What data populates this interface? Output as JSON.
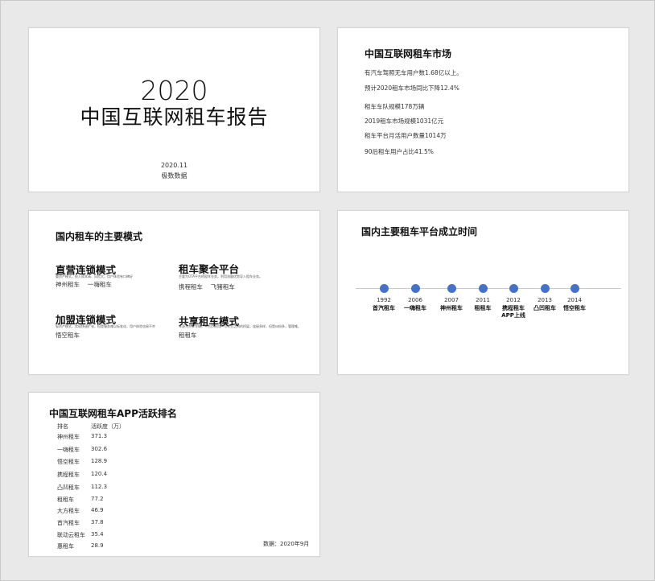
{
  "slide1": {
    "year": "2020",
    "title": "中国互联网租车报告",
    "date": "2020.11",
    "source": "极数数据"
  },
  "slide2": {
    "heading": "中国互联网租车市场",
    "lines": [
      "有汽车驾照无车用户数1.68亿以上。",
      "预计2020租车市场同比下降12.4%",
      "租车车队规模178万辆",
      "2019租车市场规模1031亿元",
      "租车平台月活用户数量1014万",
      "90后租车用户占比41.5%"
    ]
  },
  "slide3": {
    "heading": "国内租车的主要模式",
    "modes": [
      {
        "title": "直营连锁模式",
        "desc": "重资产模式，投入成本高、风险大，用户体验有口碑好",
        "examples": "神州租车　 一嗨租车"
      },
      {
        "title": "租车聚合平台",
        "desc": "主要为OTA平台的租车业务，利用流量优势导入租车业务。",
        "examples": "携程租车　 飞猪租车"
      },
      {
        "title": "加盟连锁模式",
        "desc": "轻资产模式，实现快速扩张，但是服务难以标准化，用户体验也易不齐",
        "examples": "悟空租车"
      },
      {
        "title": "共享租车模式",
        "desc": "车源为共享车辆，平台负责用户与车主之间的桥梁，连接多样，但是纠纷多，管理难。",
        "examples": "租租车"
      }
    ]
  },
  "slide4": {
    "heading": "国内主要租车平台成立时间",
    "events": [
      {
        "year": "1992",
        "name": "首汽租车"
      },
      {
        "year": "2006",
        "name": "一嗨租车"
      },
      {
        "year": "2007",
        "name": "神州租车"
      },
      {
        "year": "2011",
        "name": "租租车"
      },
      {
        "year": "2012",
        "name": "携程租车APP上线"
      },
      {
        "year": "2013",
        "name": "凸凹租车"
      },
      {
        "year": "2014",
        "name": "悟空租车"
      }
    ],
    "dot_color": "#4472c4"
  },
  "slide5": {
    "heading": "中国互联网租车APP活跃排名",
    "col_name": "排名",
    "col_value": "活跃度（万）",
    "rows": [
      {
        "name": "神州租车",
        "value": "371.3"
      },
      {
        "name": "一嗨租车",
        "value": "302.6"
      },
      {
        "name": "悟空租车",
        "value": "128.9"
      },
      {
        "name": "携程租车",
        "value": "120.4"
      },
      {
        "name": "凸凹租车",
        "value": "112.3"
      },
      {
        "name": "租租车",
        "value": "77.2"
      },
      {
        "name": "大方租车",
        "value": "46.9"
      },
      {
        "name": "首汽租车",
        "value": "37.8"
      },
      {
        "name": "联动云租车",
        "value": "35.4"
      },
      {
        "name": "惠租车",
        "value": "28.9"
      }
    ],
    "note": "数据：2020年9月"
  }
}
